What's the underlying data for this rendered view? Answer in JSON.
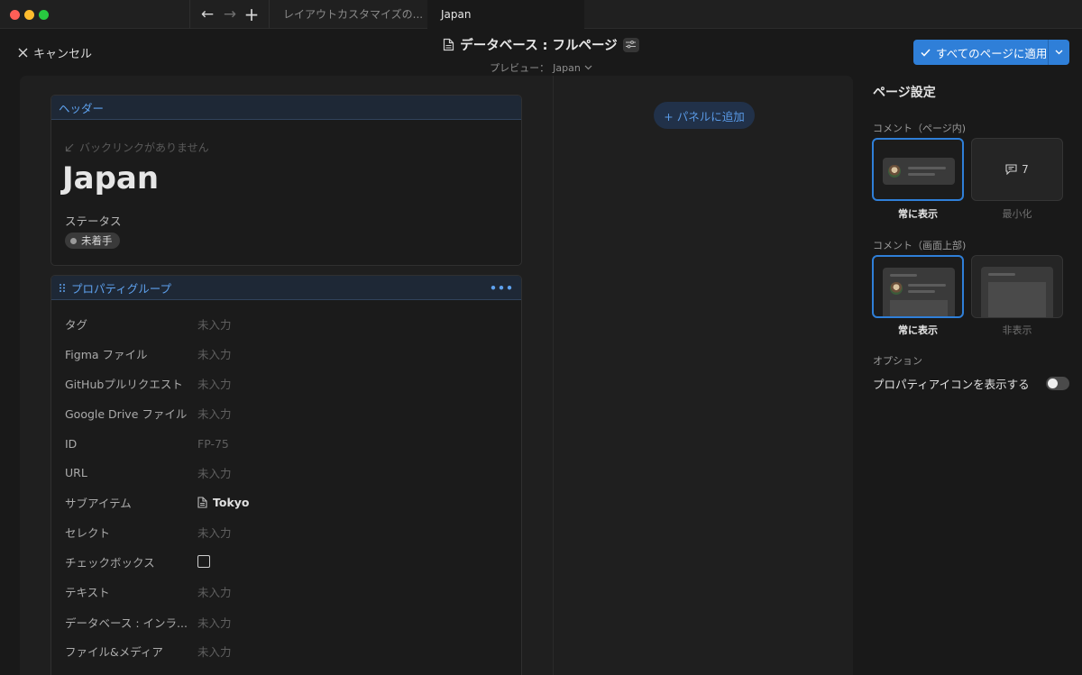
{
  "titlebar": {
    "tabs": [
      {
        "label": "レイアウトカスタマイズの..."
      },
      {
        "label": "Japan"
      }
    ],
    "back_glyph": "←",
    "forward_glyph": "→",
    "new_tab_glyph": "+"
  },
  "header": {
    "cancel_label": "キャンセル",
    "title": "データベース : フルページ",
    "preview_prefix": "プレビュー：",
    "preview_value": "Japan",
    "apply_label": "すべてのページに適用"
  },
  "canvas": {
    "add_panel_label": "+ パネルに追加",
    "header_block": {
      "label": "ヘッダー",
      "backlink": "バックリンクがありません",
      "page_title": "Japan",
      "status_label": "ステータス",
      "status_value": "未着手"
    },
    "props_block": {
      "label": "プロパティグループ",
      "more": "•••",
      "rows": [
        {
          "name": "タグ",
          "value": "未入力"
        },
        {
          "name": "Figma ファイル",
          "value": "未入力"
        },
        {
          "name": "GitHubプルリクエスト",
          "value": "未入力"
        },
        {
          "name": "Google Drive ファイル",
          "value": "未入力"
        },
        {
          "name": "ID",
          "value": "FP-75"
        },
        {
          "name": "URL",
          "value": "未入力"
        },
        {
          "name": "サブアイテム",
          "value": "Tokyo"
        },
        {
          "name": "セレクト",
          "value": "未入力"
        },
        {
          "name": "チェックボックス",
          "value": ""
        },
        {
          "name": "テキスト",
          "value": "未入力"
        },
        {
          "name": "データベース : インラ...",
          "value": "未入力"
        },
        {
          "name": "ファイル&メディア",
          "value": "未入力"
        }
      ]
    }
  },
  "settings": {
    "title": "ページ設定",
    "comment_in_page": {
      "label": "コメント（ページ内)",
      "opt_on": "常に表示",
      "opt_off": "最小化",
      "count": "7"
    },
    "comment_top": {
      "label": "コメント（画面上部)",
      "opt_on": "常に表示",
      "opt_off": "非表示"
    },
    "options": {
      "label": "オプション",
      "show_icons_label": "プロパティアイコンを表示する",
      "show_icons_on": false
    }
  },
  "colors": {
    "accent": "#2f7fd8",
    "link": "#5ea1ee",
    "background": "#191919"
  }
}
